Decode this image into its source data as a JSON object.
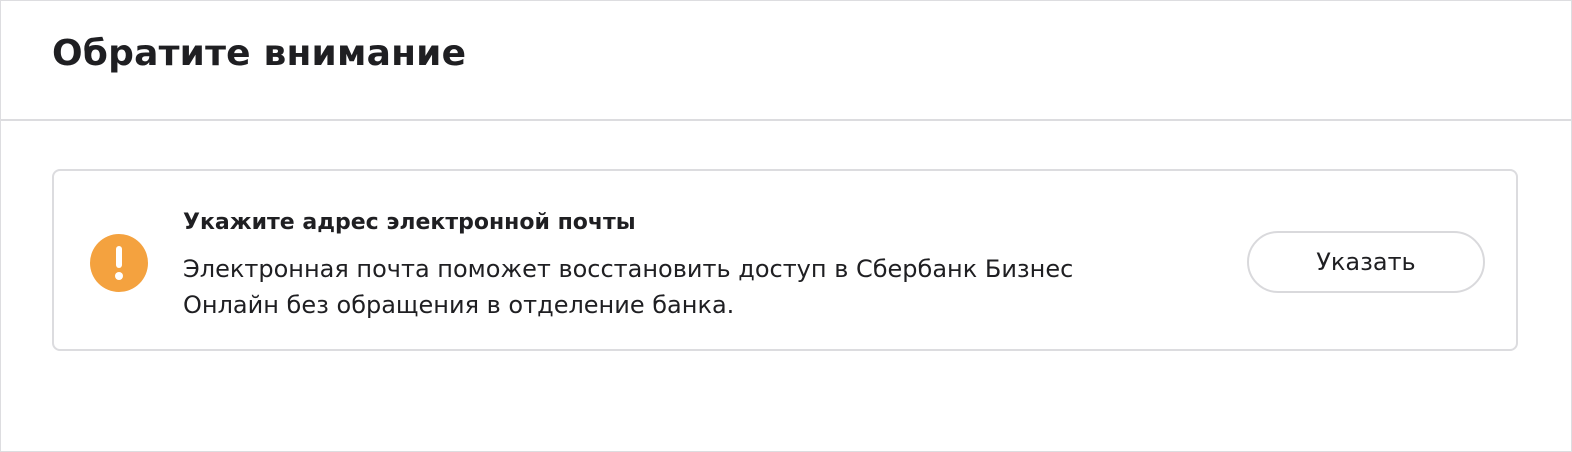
{
  "panel": {
    "title": "Обратите внимание"
  },
  "notice": {
    "icon": "exclamation-circle-icon",
    "icon_color": "#f4a23f",
    "title": "Укажите адрес электронной почты",
    "text_line1": "Электронная почта поможет восстановить доступ в Сбербанк Бизнес",
    "text_line2": "Онлайн без обращения в отделение банка.",
    "button_label": "Указать"
  }
}
